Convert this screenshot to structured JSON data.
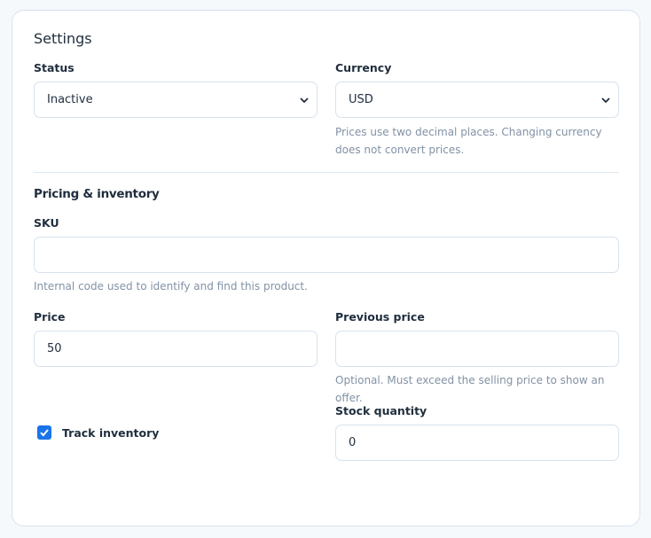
{
  "settings": {
    "title": "Settings",
    "status": {
      "label": "Status",
      "value": "Inactive"
    },
    "currency": {
      "label": "Currency",
      "value": "USD",
      "help": "Prices use two decimal places. Changing currency does not convert prices."
    }
  },
  "pricing": {
    "title": "Pricing & inventory",
    "sku": {
      "label": "SKU",
      "value": "",
      "help": "Internal code used to identify and find this product."
    },
    "price": {
      "label": "Price",
      "value": "50"
    },
    "previous_price": {
      "label": "Previous price",
      "value": "",
      "help": "Optional. Must exceed the selling price to show an offer."
    },
    "track_inventory": {
      "label": "Track inventory",
      "checked": true
    },
    "stock_quantity": {
      "label": "Stock quantity",
      "value": "0"
    }
  },
  "colors": {
    "accent": "#1a73e8",
    "border": "#d6e2ee",
    "help_text": "#8392a5"
  }
}
